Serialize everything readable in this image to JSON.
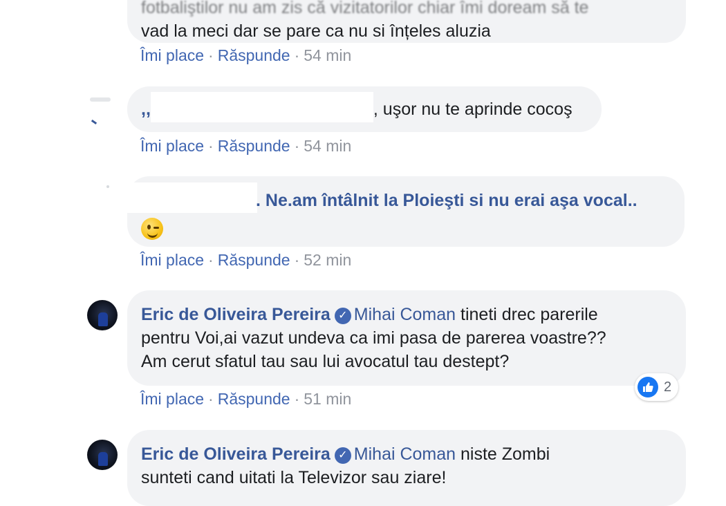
{
  "comments": [
    {
      "text_line1": "fotbaliştilor nu am zis că vizitatorilor chiar îmi doream să te",
      "text_line2": "vad la meci dar se pare ca nu si înțeles aluzia",
      "actions": {
        "like": "Îmi place",
        "reply": "Răspunde",
        "time": "54 min"
      }
    },
    {
      "prefix": ",,",
      "text": ", uşor nu te aprinde cocoş",
      "actions": {
        "like": "Îmi place",
        "reply": "Răspunde",
        "time": "54 min"
      }
    },
    {
      "text": ". Ne.am întâlnit la Ploieşti si nu erai aşa vocal..",
      "emoji": "wink-emoji",
      "actions": {
        "like": "Îmi place",
        "reply": "Răspunde",
        "time": "52 min"
      }
    },
    {
      "author": "Eric de Oliveira Pereira",
      "mention": "Mihai Coman",
      "text_line1": " tineti drec parerile",
      "text_line2": "pentru Voi,ai vazut undeva ca imi pasa de parerea voastre??",
      "text_line3": "Am cerut sfatul tau sau lui avocatul tau destept?",
      "reactions": {
        "icon": "like-icon",
        "count": "2"
      },
      "actions": {
        "like": "Îmi place",
        "reply": "Răspunde",
        "time": "51 min"
      }
    },
    {
      "author": "Eric de Oliveira Pereira",
      "mention": "Mihai Coman",
      "text_line1": " niste Zombi",
      "text_line2": "sunteti cand uitati la Televizor sau ziare!"
    }
  ],
  "separator": "·",
  "colors": {
    "bubble": "#f2f3f5",
    "link": "#385898",
    "action_link": "#4267b2",
    "meta": "#90949c"
  }
}
